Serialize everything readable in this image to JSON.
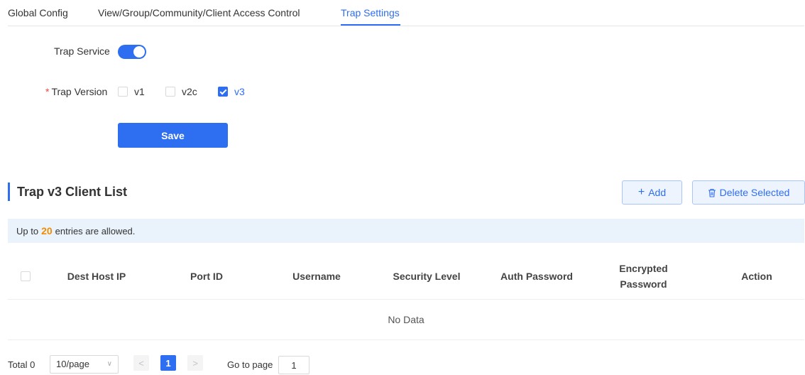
{
  "tabs": [
    {
      "label": "Global Config"
    },
    {
      "label": "View/Group/Community/Client Access Control"
    },
    {
      "label": "Trap Settings"
    }
  ],
  "active_tab": "Trap Settings",
  "form": {
    "trap_service_label": "Trap Service",
    "trap_service_enabled": true,
    "trap_version_required_mark": "*",
    "trap_version_label": "Trap Version",
    "versions": [
      {
        "label": "v1",
        "checked": false
      },
      {
        "label": "v2c",
        "checked": false
      },
      {
        "label": "v3",
        "checked": true
      }
    ],
    "save_label": "Save"
  },
  "section": {
    "title": "Trap v3 Client List",
    "add_icon": "plus-icon",
    "add_label": "Add",
    "delete_icon": "trash-icon",
    "delete_label": "Delete Selected"
  },
  "info": {
    "prefix": "Up to",
    "count": "20",
    "suffix": "entries are allowed."
  },
  "table": {
    "columns": [
      "Dest Host IP",
      "Port ID",
      "Username",
      "Security Level",
      "Auth Password",
      "Encrypted Password",
      "Action"
    ],
    "empty_text": "No Data"
  },
  "pagination": {
    "total_label": "Total 0",
    "page_size": "10/page",
    "prev": "<",
    "current_page": "1",
    "next": ">",
    "goto_label": "Go to page",
    "goto_value": "1"
  },
  "colors": {
    "accent": "#2e6ef0",
    "required": "#f0473c",
    "count_highlight": "#f08c00",
    "info_bg": "#eaf3fc"
  }
}
